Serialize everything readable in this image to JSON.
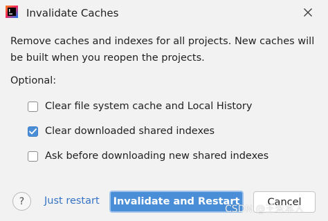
{
  "dialog": {
    "title": "Invalidate Caches",
    "app_icon": "intellij-logo-icon",
    "close_icon": "close-icon"
  },
  "description": "Remove caches and indexes for all projects. New caches will be built when you reopen the projects.",
  "optional_label": "Optional:",
  "options": [
    {
      "label": "Clear file system cache and Local History",
      "checked": false
    },
    {
      "label": "Clear downloaded shared indexes",
      "checked": true
    },
    {
      "label": "Ask before downloading new shared indexes",
      "checked": false
    }
  ],
  "footer": {
    "help_label": "?",
    "just_restart_label": "Just restart",
    "invalidate_label": "Invalidate and Restart",
    "cancel_label": "Cancel"
  },
  "watermark": "CSDN @王朱本人",
  "colors": {
    "primary": "#4a8ed8",
    "link": "#3574c5",
    "background": "#f2f2f2"
  }
}
